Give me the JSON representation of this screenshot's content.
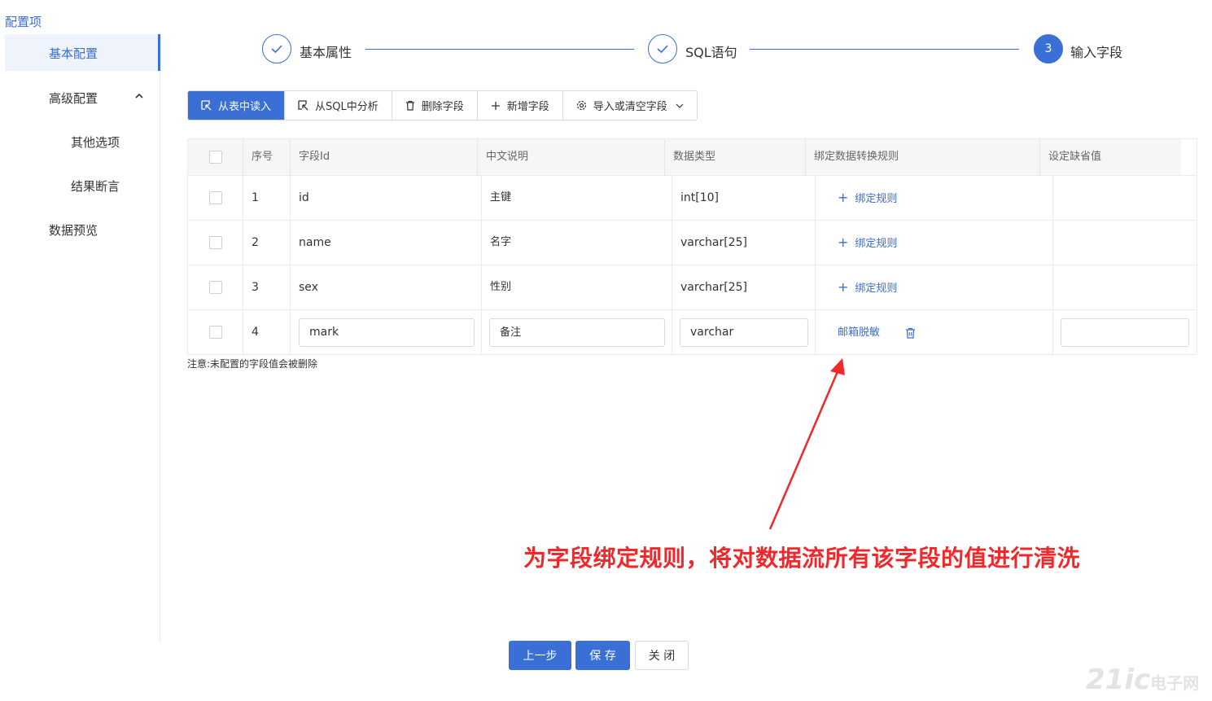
{
  "sidebar": {
    "title": "配置项",
    "items": [
      {
        "label": "基本配置"
      },
      {
        "label": "高级配置"
      },
      {
        "label": "其他选项"
      },
      {
        "label": "结果断言"
      },
      {
        "label": "数据预览"
      }
    ]
  },
  "steps": [
    {
      "label": "基本属性",
      "status": "done"
    },
    {
      "label": "SQL语句",
      "status": "done"
    },
    {
      "label": "输入字段",
      "status": "active",
      "number": "3"
    }
  ],
  "toolbar": {
    "read_from_table": "从表中读入",
    "analyze_sql": "从SQL中分析",
    "delete_field": "删除字段",
    "add_field": "新增字段",
    "import_clear": "导入或清空字段"
  },
  "table": {
    "headers": [
      "序号",
      "字段Id",
      "中文说明",
      "数据类型",
      "绑定数据转换规则",
      "设定缺省值"
    ],
    "rows": [
      {
        "no": "1",
        "field_id": "id",
        "desc": "主键",
        "type": "int[10]",
        "rule": "绑定规则"
      },
      {
        "no": "2",
        "field_id": "name",
        "desc": "名字",
        "type": "varchar[25]",
        "rule": "绑定规则"
      },
      {
        "no": "3",
        "field_id": "sex",
        "desc": "性别",
        "type": "varchar[25]",
        "rule": "绑定规则"
      },
      {
        "no": "4",
        "field_id": "mark",
        "desc": "备注",
        "type": "varchar",
        "rule": "邮箱脱敏",
        "default": ""
      }
    ]
  },
  "note": "注意:未配置的字段值会被删除",
  "annotation": "为字段绑定规则，将对数据流所有该字段的值进行清洗",
  "footer": {
    "prev": "上一步",
    "save": "保 存",
    "close": "关 闭"
  },
  "watermark": {
    "main": "21ic",
    "sub": "电子网"
  },
  "colors": {
    "accent": "#3a6fd6",
    "annotation": "#f0282a"
  }
}
